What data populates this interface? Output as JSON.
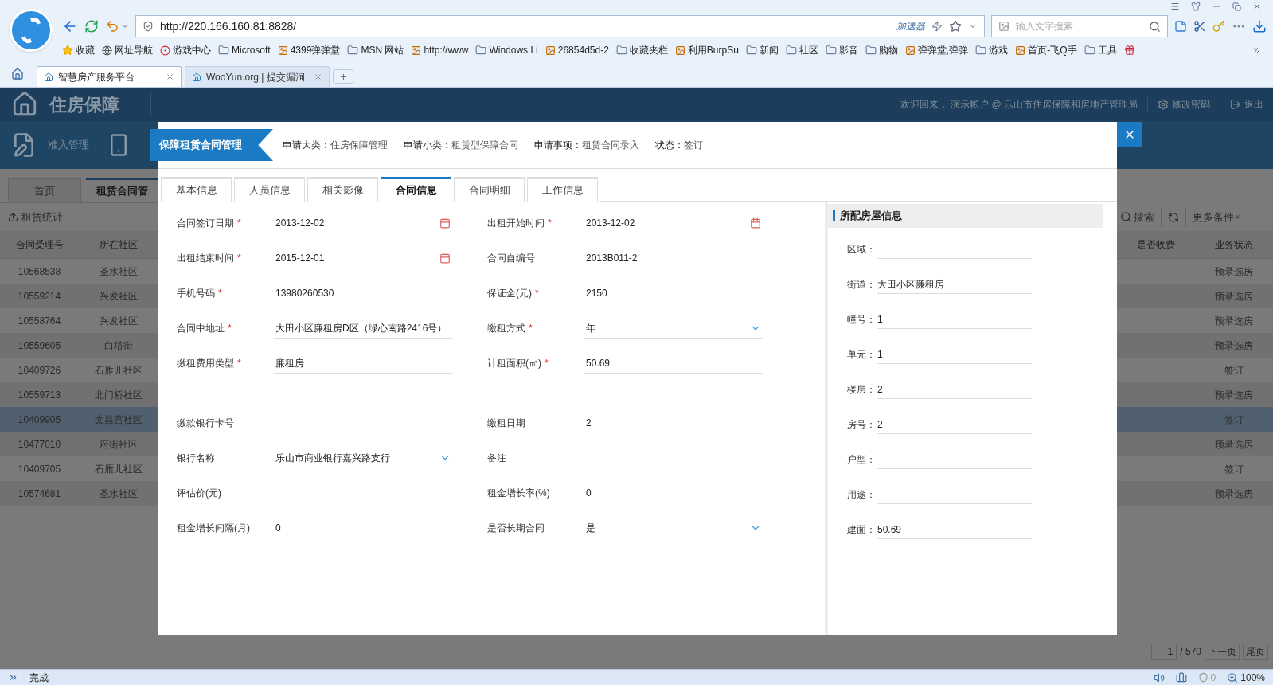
{
  "browser": {
    "address": "http://220.166.160.81:8828/",
    "accelerator": "加速器",
    "search_placeholder": "输入文字搜索",
    "bookmarks": [
      {
        "label": "收藏",
        "kind": "favorites"
      },
      {
        "label": "网址导航",
        "kind": "globe"
      },
      {
        "label": "游戏中心",
        "kind": "game"
      },
      {
        "label": "Microsoft",
        "kind": "folder"
      },
      {
        "label": "4399弹弹堂",
        "kind": "site"
      },
      {
        "label": "MSN 网站",
        "kind": "folder"
      },
      {
        "label": "http://www",
        "kind": "site"
      },
      {
        "label": "Windows Li",
        "kind": "folder"
      },
      {
        "label": "26854d5d-2",
        "kind": "site"
      },
      {
        "label": "收藏夹栏",
        "kind": "folder"
      },
      {
        "label": "利用BurpSu",
        "kind": "site"
      },
      {
        "label": "新闻",
        "kind": "folder"
      },
      {
        "label": "社区",
        "kind": "folder"
      },
      {
        "label": "影音",
        "kind": "folder"
      },
      {
        "label": "购物",
        "kind": "folder"
      },
      {
        "label": "弹弹堂,弹弹",
        "kind": "site"
      },
      {
        "label": "游戏",
        "kind": "folder"
      },
      {
        "label": "首页-飞Q手",
        "kind": "site"
      },
      {
        "label": "工具",
        "kind": "folder"
      }
    ],
    "tabs": [
      {
        "label": "智慧房产服务平台",
        "selected": true
      },
      {
        "label": "WooYun.org | 提交漏洞",
        "selected": false
      }
    ]
  },
  "app": {
    "title": "住房保障",
    "welcome": "欢迎回来， 演示帐户 @ 乐山市住房保障和房地产管理局",
    "change_password": "修改密码",
    "logout": "退出",
    "nav": [
      {
        "label": "准入管理"
      }
    ],
    "page_tabs": [
      {
        "label": "首页",
        "selected": false
      },
      {
        "label": "租赁合同管",
        "selected": true
      }
    ],
    "toolbar": {
      "export": "租赁统计",
      "search": "搜索",
      "more": "更多条件"
    },
    "table": {
      "columns_left": [
        "合同受理号",
        "所在社区"
      ],
      "columns_right": [
        "是否收费",
        "业务状态"
      ],
      "rows": [
        {
          "id": "10568538",
          "community": "圣水社区",
          "status": "预录选房",
          "selected": false
        },
        {
          "id": "10559214",
          "community": "兴发社区",
          "status": "预录选房",
          "selected": false
        },
        {
          "id": "10558764",
          "community": "兴发社区",
          "status": "预录选房",
          "selected": false
        },
        {
          "id": "10559605",
          "community": "白塔街",
          "status": "预录选房",
          "selected": false
        },
        {
          "id": "10409726",
          "community": "石雁儿社区",
          "status": "签订",
          "selected": false
        },
        {
          "id": "10559713",
          "community": "北门桥社区",
          "status": "预录选房",
          "selected": false
        },
        {
          "id": "10409905",
          "community": "文昌宫社区",
          "status": "签订",
          "selected": true
        },
        {
          "id": "10477010",
          "community": "府街社区",
          "status": "预录选房",
          "selected": false
        },
        {
          "id": "10409705",
          "community": "石雁儿社区",
          "status": "签订",
          "selected": false
        },
        {
          "id": "10574681",
          "community": "圣水社区",
          "status": "预录选房",
          "selected": false
        }
      ]
    },
    "pagination": {
      "page": "1",
      "total": "/ 570",
      "next": "下一页",
      "last": "尾页"
    }
  },
  "modal": {
    "title": "保障租赁合同管理",
    "info": [
      {
        "label": "申请大类：",
        "value": "住房保障管理"
      },
      {
        "label": "申请小类：",
        "value": "租赁型保障合同"
      },
      {
        "label": "申请事项：",
        "value": "租赁合同录入"
      },
      {
        "label": "状态：",
        "value": "签订"
      }
    ],
    "required_mark": "*",
    "tabs": [
      {
        "label": "基本信息",
        "selected": false
      },
      {
        "label": "人员信息",
        "selected": false
      },
      {
        "label": "相关影像",
        "selected": false
      },
      {
        "label": "合同信息",
        "selected": true
      },
      {
        "label": "合同明细",
        "selected": false
      },
      {
        "label": "工作信息",
        "selected": false
      }
    ],
    "form_groups": [
      [
        {
          "label": "合同签订日期",
          "required": true,
          "kind": "date",
          "value": "2013-12-02"
        },
        {
          "label": "出租开始时间",
          "required": true,
          "kind": "date",
          "value": "2013-12-02"
        },
        {
          "label": "出租结束时间",
          "required": true,
          "kind": "date",
          "value": "2015-12-01"
        },
        {
          "label": "合同自编号",
          "required": false,
          "kind": "text",
          "value": "2013B011-2"
        },
        {
          "label": "手机号码",
          "required": true,
          "kind": "text",
          "value": "13980260530"
        },
        {
          "label": "保证金(元)",
          "required": true,
          "kind": "text",
          "value": "2150"
        },
        {
          "label": "合同中地址",
          "required": true,
          "kind": "text",
          "value": "大田小区廉租房D区（绿心南路2416号）"
        },
        {
          "label": "缴租方式",
          "required": true,
          "kind": "select",
          "value": "年"
        },
        {
          "label": "缴租费用类型",
          "required": true,
          "kind": "text",
          "value": "廉租房"
        },
        {
          "label": "计租面积(㎡)",
          "required": true,
          "kind": "text",
          "value": "50.69"
        }
      ],
      [
        {
          "label": "缴款银行卡号",
          "required": false,
          "kind": "text"
        },
        {
          "label": "缴租日期",
          "required": false,
          "kind": "text",
          "value": "2"
        },
        {
          "label": "银行名称",
          "required": false,
          "kind": "select",
          "value": "乐山市商业银行嘉兴路支行"
        },
        {
          "label": "备注",
          "required": false,
          "kind": "text"
        },
        {
          "label": "评估价(元)",
          "required": false,
          "kind": "text"
        },
        {
          "label": "租金增长率(%)",
          "required": false,
          "kind": "text",
          "value": "0"
        },
        {
          "label": "租金增长间隔(月)",
          "required": false,
          "kind": "text",
          "value": "0"
        },
        {
          "label": "是否长期合同",
          "required": false,
          "kind": "select",
          "value": "是"
        }
      ]
    ],
    "house_panel": {
      "title": "所配房屋信息",
      "fields": [
        {
          "label": "区域："
        },
        {
          "label": "街道：",
          "value": "大田小区廉租房"
        },
        {
          "label": "幢号：",
          "value": "1"
        },
        {
          "label": "单元：",
          "value": "1"
        },
        {
          "label": "楼层：",
          "value": "2"
        },
        {
          "label": "房号：",
          "value": "2"
        },
        {
          "label": "户型："
        },
        {
          "label": "用途："
        },
        {
          "label": "建面：",
          "value": "50.69"
        }
      ]
    }
  },
  "status_bar": {
    "text": "完成",
    "count": "0",
    "zoom": "100%"
  }
}
